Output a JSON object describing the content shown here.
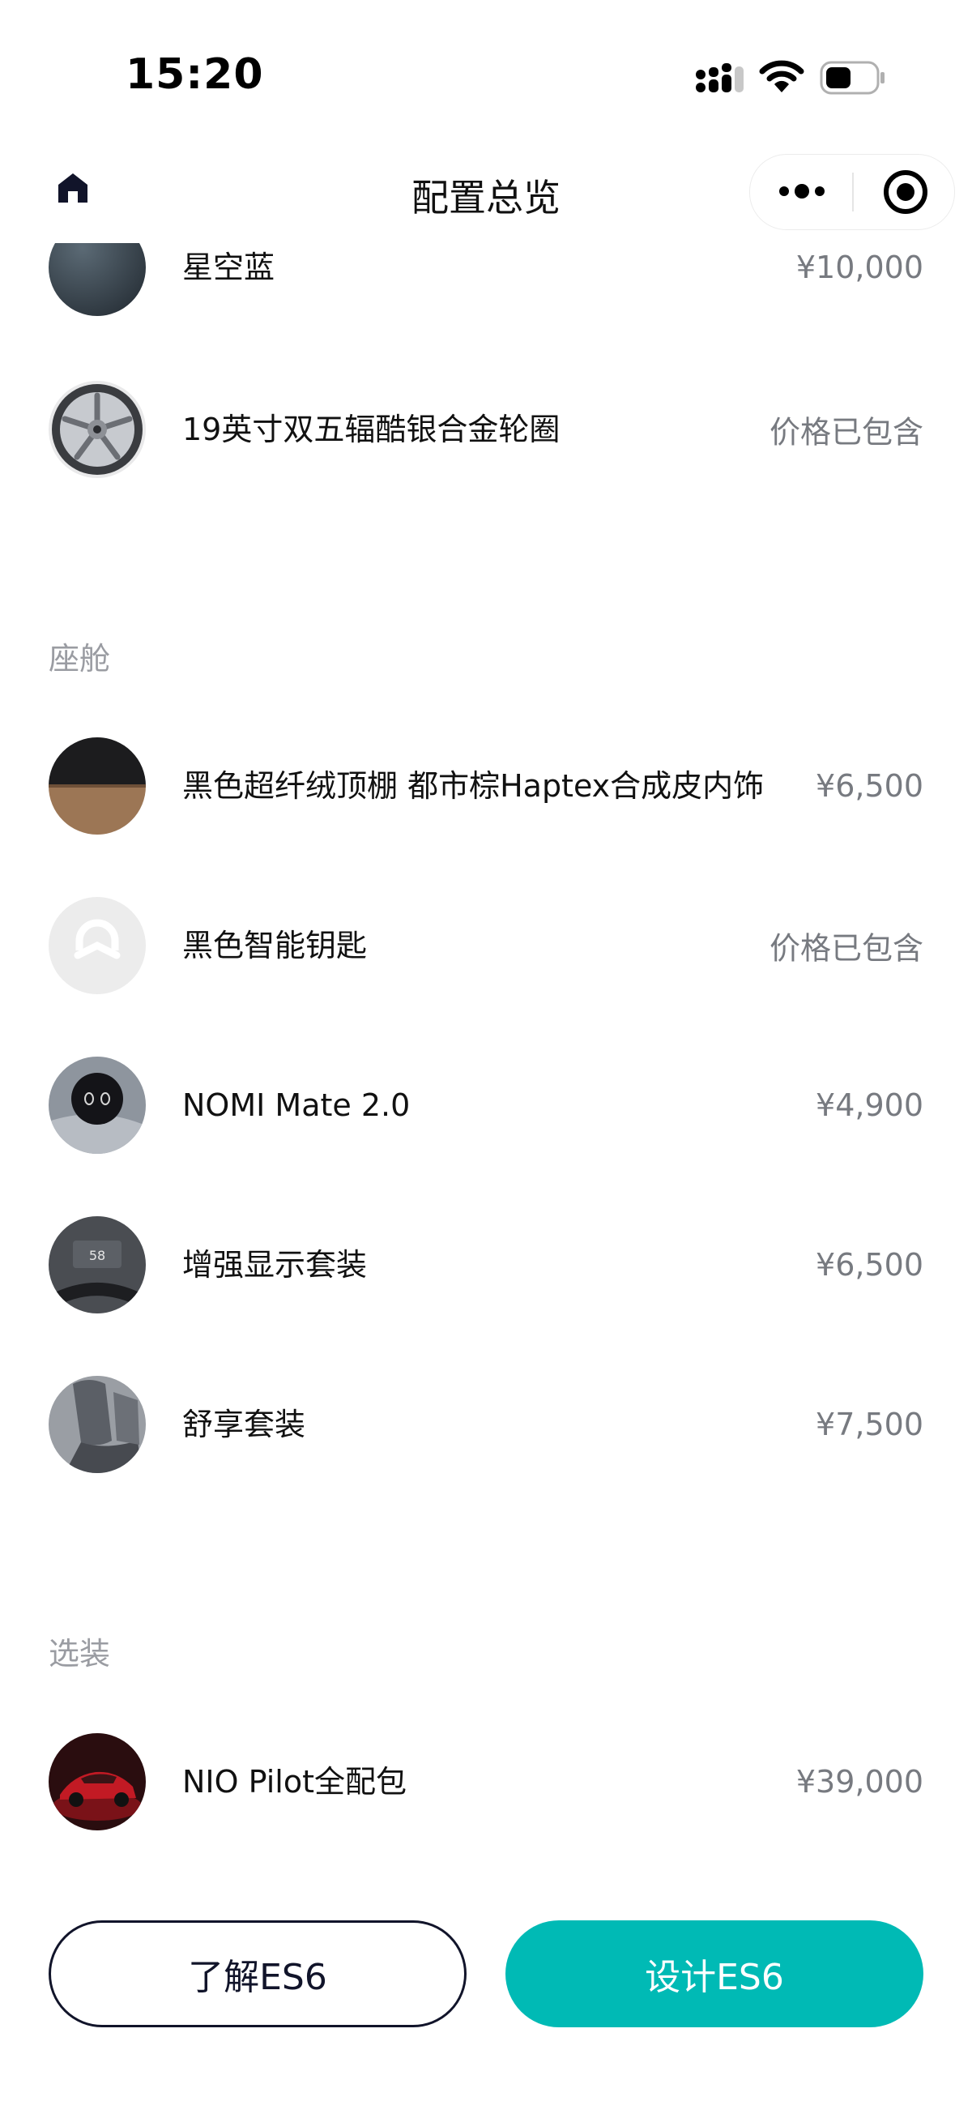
{
  "status_bar": {
    "time": "15:20"
  },
  "nav": {
    "title": "配置总览"
  },
  "exterior_items": [
    {
      "name": "星空蓝",
      "price": "¥10,000",
      "icon": "paint-swatch-icon"
    },
    {
      "name": "19英寸双五辐酷银合金轮圈",
      "price": "价格已包含",
      "icon": "wheel-icon"
    }
  ],
  "cabin": {
    "title": "座舱",
    "items": [
      {
        "name": "黑色超纤绒顶棚 都市棕Haptex合成皮内饰",
        "price": "¥6,500",
        "icon": "interior-swatch-icon"
      },
      {
        "name": "黑色智能钥匙",
        "price": "价格已包含",
        "icon": "nio-key-icon"
      },
      {
        "name": "NOMI Mate 2.0",
        "price": "¥4,900",
        "icon": "nomi-icon"
      },
      {
        "name": "增强显示套装",
        "price": "¥6,500",
        "icon": "hud-icon"
      },
      {
        "name": "舒享套装",
        "price": "¥7,500",
        "icon": "seat-icon"
      }
    ]
  },
  "options": {
    "title": "选装",
    "items": [
      {
        "name": "NIO Pilot全配包",
        "price": "¥39,000",
        "icon": "car-photo-icon"
      }
    ]
  },
  "buttons": {
    "learn": "了解ES6",
    "design": "设计ES6"
  },
  "colors": {
    "accent": "#00bab5",
    "outline": "#11142a",
    "price_text": "#777a80",
    "section_text": "#9a9ca2"
  }
}
